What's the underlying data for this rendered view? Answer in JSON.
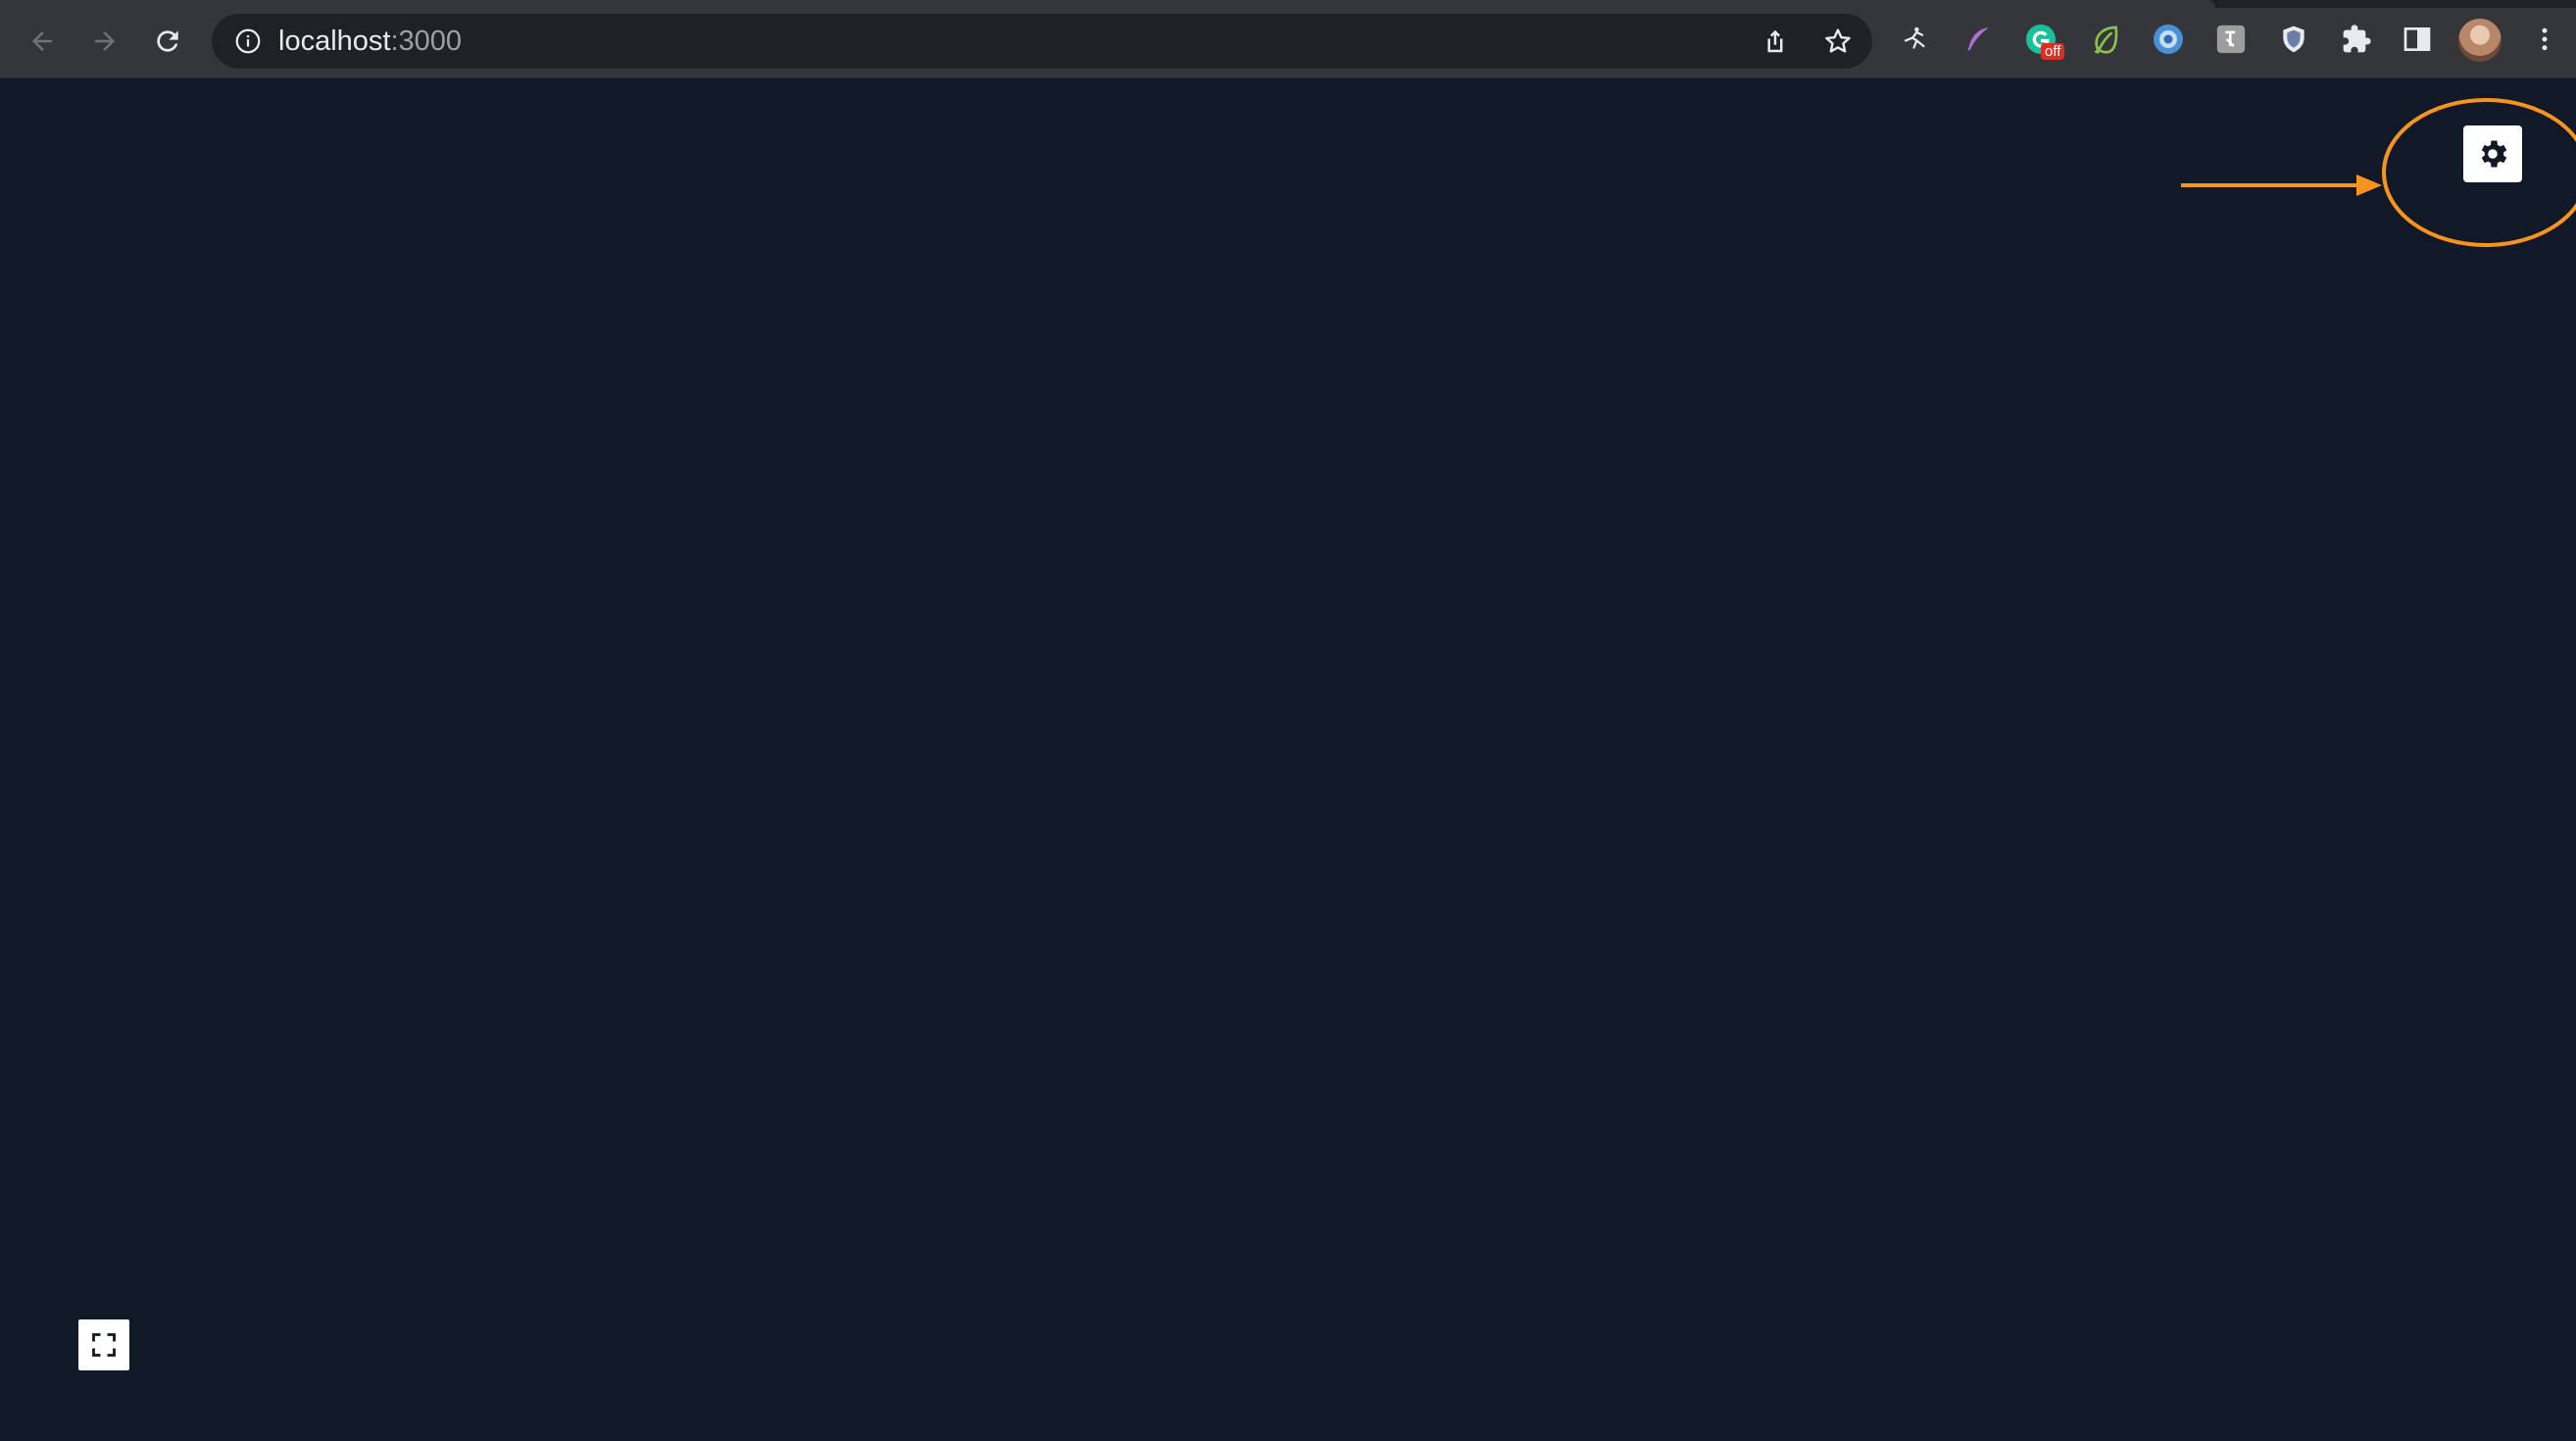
{
  "browser": {
    "url_host": "localhost",
    "url_port": ":3000",
    "extension_badge": "off",
    "extensions": [
      "dancer-icon",
      "feather-icon",
      "grammarly-icon",
      "leaf-icon",
      "ring-icon",
      "translate-icon",
      "shield-icon",
      "puzzle-icon",
      "side-panel-icon"
    ]
  },
  "page": {
    "background": "#111827",
    "settings_icon": "gear-icon",
    "fullscreen_icon": "expand-icon"
  },
  "annotation": {
    "color": "#f7941d",
    "shapes": [
      "arrow",
      "ellipse"
    ]
  }
}
